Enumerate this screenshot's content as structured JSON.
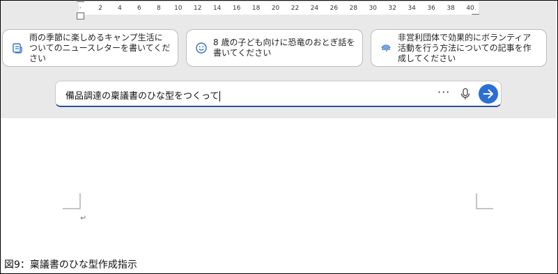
{
  "ruler": {
    "ticks": [
      "2",
      "4",
      "6",
      "8",
      "10",
      "12",
      "14",
      "16",
      "18",
      "20",
      "22",
      "24",
      "26",
      "28",
      "30",
      "32",
      "34",
      "36",
      "38",
      "40"
    ]
  },
  "suggestions": [
    {
      "icon": "newsletter-icon",
      "text": "雨の季節に楽しめるキャンプ生活についてのニュースレターを書いてください"
    },
    {
      "icon": "smiley-icon",
      "text": "8 歳の子ども向けに恐竜のおとぎ話を書いてください"
    },
    {
      "icon": "fingerprint-icon",
      "text": "非営利団体で効果的にボランティア活動を行う方法についての記事を作成してください"
    }
  ],
  "prompt": {
    "value": "備品調達の稟議書のひな型をつくって",
    "more_label": "···"
  },
  "document": {
    "paragraph_mark": "↵"
  },
  "caption": "図9：稟議書のひな型作成指示",
  "colors": {
    "accent": "#2a6fd6",
    "underline": "#2a4f9c",
    "toolbar_bg": "#e9e9e9"
  }
}
